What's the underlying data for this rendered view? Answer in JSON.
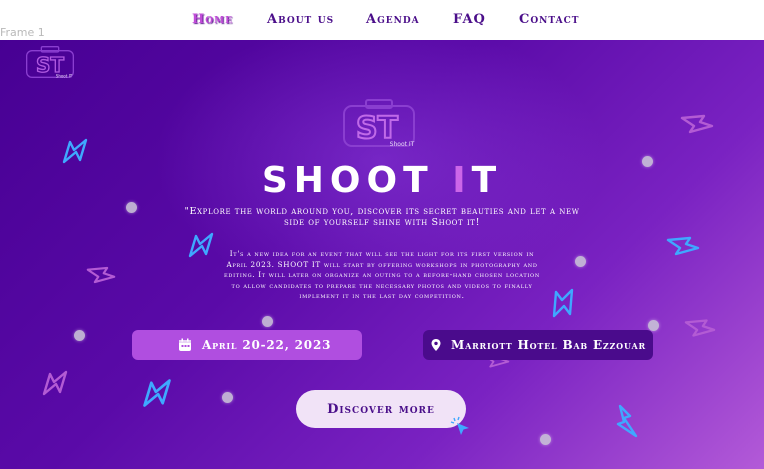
{
  "nav": {
    "items": [
      {
        "label": "Home",
        "active": true
      },
      {
        "label": "About us",
        "active": false
      },
      {
        "label": "Agenda",
        "active": false
      },
      {
        "label": "FAQ",
        "active": false
      },
      {
        "label": "Contact",
        "active": false
      }
    ]
  },
  "frame_label": "Frame 1",
  "logo": {
    "text": "ST",
    "caption": "Shoot IT"
  },
  "hero": {
    "title_part1": "SHOO",
    "title_part2": "T ",
    "title_part3": "I",
    "title_part4": "T",
    "tagline": "\"Explore the world around you, discover its secret beauties and let a new side of yourself shine with Shoot it!",
    "description": "It's a new idea for an event that will see the light for its first version in April 2023. SHOOT IT will start by offering workshops in photography and editing. It will later on organize an outing to a before-hand chosen location to allow candidates to prepare the necessary photos and videos to finally implement it in the last day competition.",
    "date_label": "April 20-22, 2023",
    "location_label": "Marriott Hotel Bab Ezzouar",
    "cta_label": "Discover more"
  },
  "icons": {
    "calendar": "calendar-icon",
    "location": "location-pin-icon",
    "cursor": "click-cursor-icon",
    "decoration": "lightning-bolt-icon"
  },
  "colors": {
    "nav_text": "#4b0f8a",
    "nav_active": "#c14bd8",
    "hero_dark": "#470093",
    "hero_light": "#b35ad8",
    "accent": "#cc66e8",
    "date_pill": "#b04ee0",
    "location_pill": "#4a0b8c",
    "cta_bg": "#f1e3f7",
    "bolt_blue": "#3fa8ff",
    "bolt_pink": "#b35bd4"
  }
}
